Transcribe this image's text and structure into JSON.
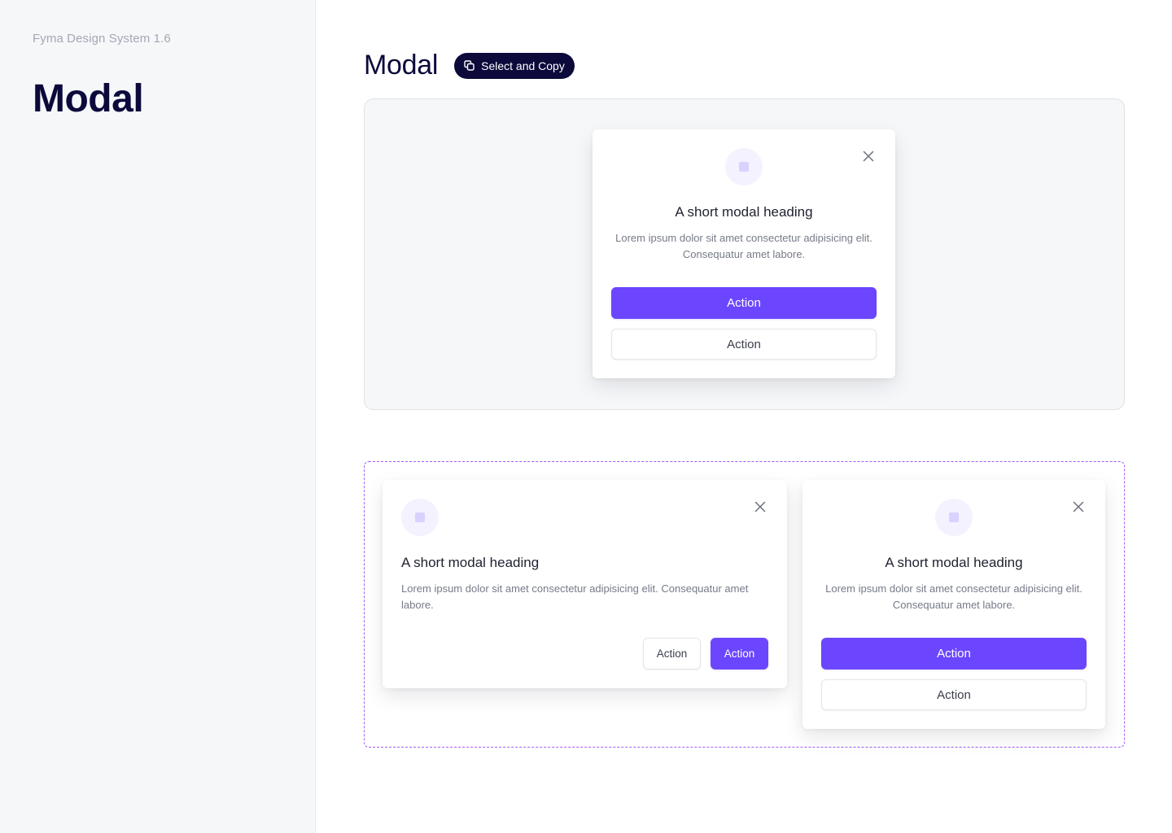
{
  "sidebar": {
    "system_name": "Fyma Design System 1.6",
    "title": "Modal"
  },
  "header": {
    "title": "Modal",
    "copy_button_label": "Select and Copy",
    "copy_icon": "copy-icon"
  },
  "colors": {
    "primary": "#6b46fe",
    "navy": "#0b0a3b",
    "dashed_border": "#a35cf5",
    "sidebar_bg": "#f6f7f9"
  },
  "modals": [
    {
      "variant": "centered-stacked",
      "icon": "feature-icon",
      "close_icon": "close-icon",
      "heading": "A short modal heading",
      "body": "Lorem ipsum dolor sit amet consectetur adipisicing elit. Consequatur amet labore.",
      "primary_action": "Action",
      "secondary_action": "Action"
    },
    {
      "variant": "left-aligned-inline",
      "icon": "feature-icon",
      "close_icon": "close-icon",
      "heading": "A short modal heading",
      "body": "Lorem ipsum dolor sit amet consectetur adipisicing elit. Consequatur amet labore.",
      "primary_action": "Action",
      "secondary_action": "Action"
    },
    {
      "variant": "centered-stacked",
      "icon": "feature-icon",
      "close_icon": "close-icon",
      "heading": "A short modal heading",
      "body": "Lorem ipsum dolor sit amet consectetur adipisicing elit. Consequatur amet labore.",
      "primary_action": "Action",
      "secondary_action": "Action"
    }
  ]
}
